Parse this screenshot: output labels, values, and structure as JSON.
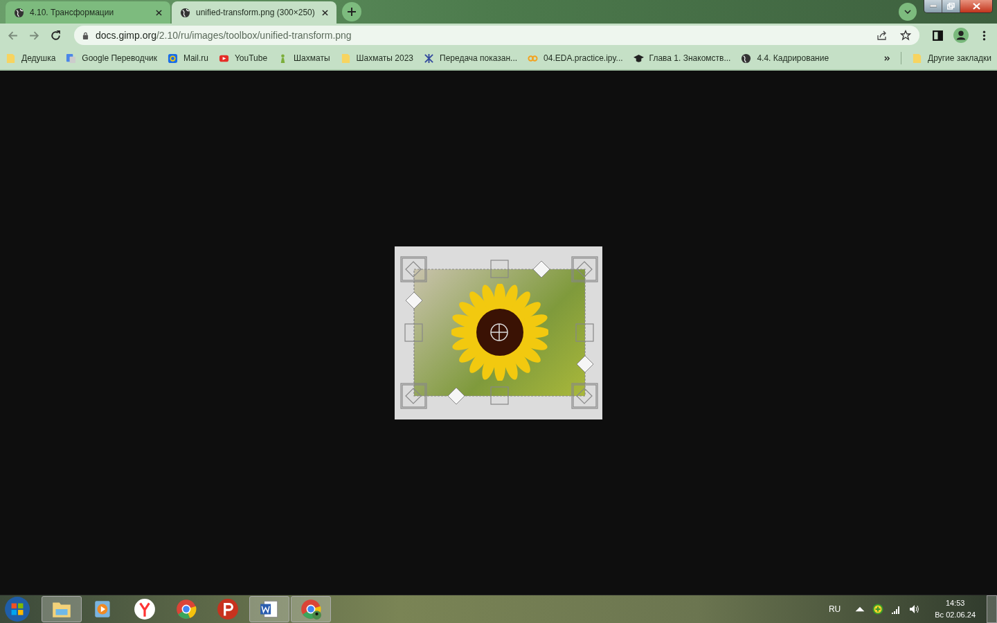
{
  "tabs": [
    {
      "title": "4.10. Трансформации",
      "selected": false
    },
    {
      "title": "unified-transform.png (300×250)",
      "selected": true
    }
  ],
  "address": {
    "host": "docs.gimp.org",
    "path": "/2.10/ru/images/toolbox/unified-transform.png"
  },
  "bookmarks": [
    {
      "label": "Дедушка",
      "kind": "folder"
    },
    {
      "label": "Google Переводчик",
      "kind": "translate"
    },
    {
      "label": "Mail.ru",
      "kind": "mail"
    },
    {
      "label": "YouTube",
      "kind": "youtube"
    },
    {
      "label": "Шахматы",
      "kind": "chess"
    },
    {
      "label": "Шахматы 2023",
      "kind": "folder"
    },
    {
      "label": "Передача показан...",
      "kind": "web"
    },
    {
      "label": "04.EDA.practice.ipy...",
      "kind": "colab"
    },
    {
      "label": "Глава 1. Знакомств...",
      "kind": "course"
    },
    {
      "label": "4.4. Кадрирование",
      "kind": "globe"
    }
  ],
  "other_bookmarks": "Другие закладки",
  "taskbar": [
    {
      "kind": "explorer",
      "running": true
    },
    {
      "kind": "player",
      "running": false
    },
    {
      "kind": "yandex",
      "running": false
    },
    {
      "kind": "chrome",
      "running": false
    },
    {
      "kind": "psiphon",
      "running": false
    },
    {
      "kind": "word",
      "running": true
    },
    {
      "kind": "chrome-profile",
      "running": true
    }
  ],
  "tray": {
    "language": "RU",
    "time": "14:53",
    "date": "Вс 02.06.24"
  }
}
